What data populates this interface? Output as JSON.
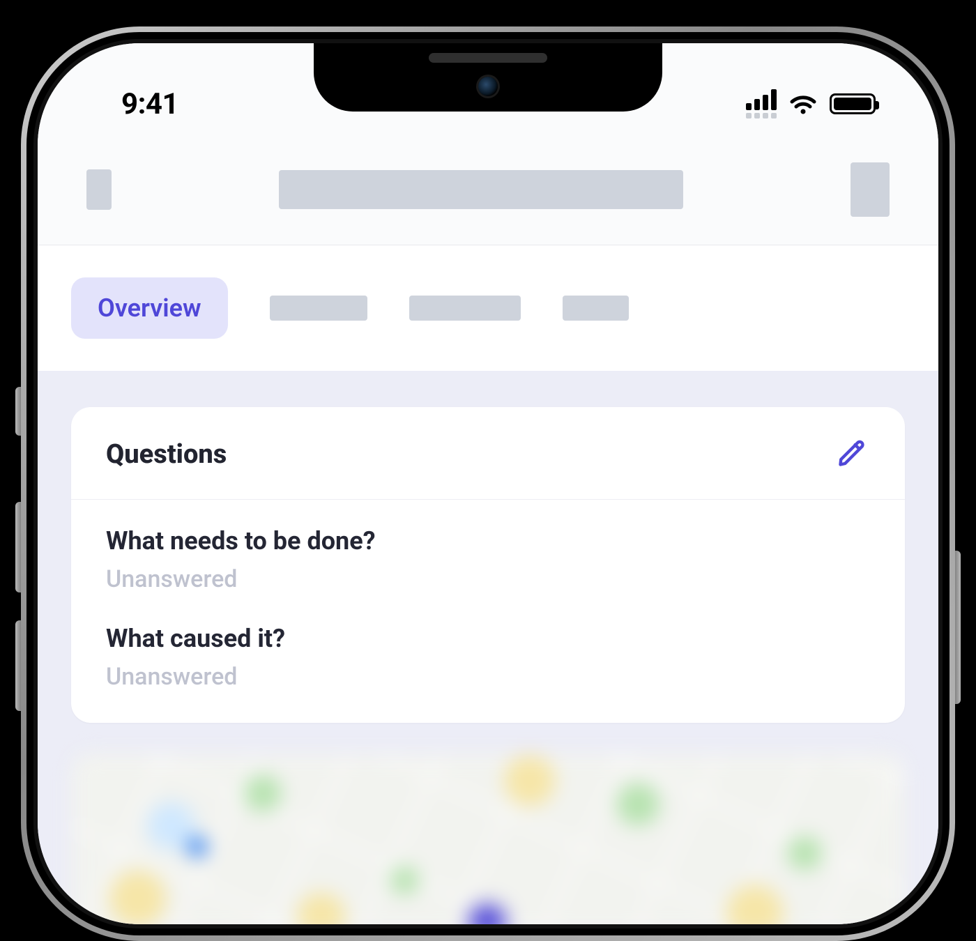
{
  "status_bar": {
    "time": "9:41"
  },
  "tabs": {
    "active": "Overview"
  },
  "questions_card": {
    "title": "Questions",
    "items": [
      {
        "question": "What needs to be done?",
        "answer": "Unanswered"
      },
      {
        "question": "What caused it?",
        "answer": "Unanswered"
      }
    ]
  },
  "colors": {
    "accent": "#4f47d8",
    "accent_bg": "#e3e3fb",
    "skeleton": "#ced3dc",
    "page_bg": "#ecedf7"
  }
}
